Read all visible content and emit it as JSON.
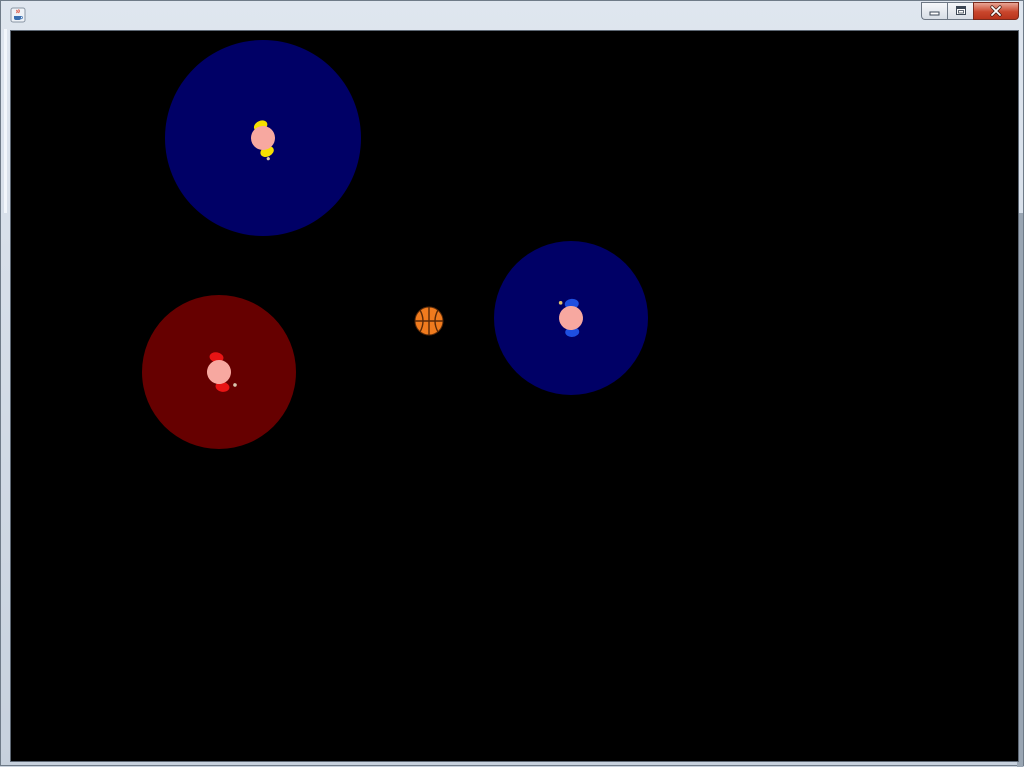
{
  "window": {
    "title": "",
    "controls": [
      {
        "name": "minimize-button",
        "icon": "minimize-icon"
      },
      {
        "name": "maximize-button",
        "icon": "maximize-icon"
      },
      {
        "name": "close-button",
        "icon": "close-icon"
      }
    ],
    "app_icon": "java-cup-icon"
  },
  "game": {
    "background": "#000000",
    "ball": {
      "icon": "basketball-icon",
      "color": "#f07b1e",
      "seam_color": "#5a2a08"
    },
    "players": [
      {
        "name": "player-yellow",
        "zone_color": "#000066",
        "shirt_color": "#f5e000",
        "head_color": "#f7a8a0"
      },
      {
        "name": "player-blue",
        "zone_color": "#000066",
        "shirt_color": "#1e4fe0",
        "head_color": "#f7a8a0"
      },
      {
        "name": "player-red",
        "zone_color": "#660000",
        "shirt_color": "#e81414",
        "head_color": "#f7a8a0"
      }
    ]
  }
}
